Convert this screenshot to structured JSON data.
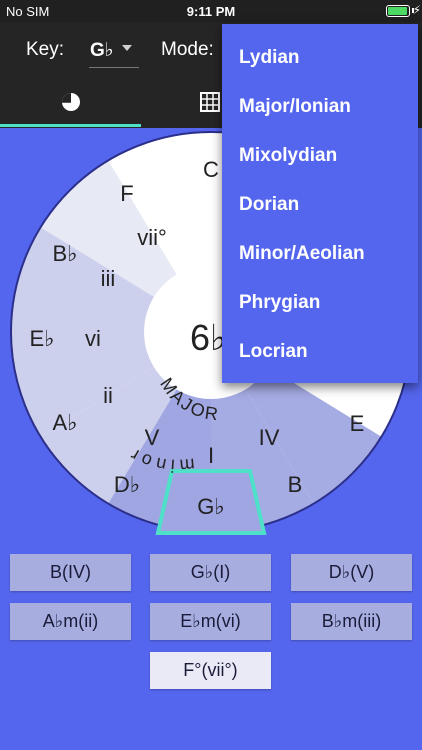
{
  "status": {
    "carrier": "No SIM",
    "time": "9:11 PM",
    "charge_icon": "⚡"
  },
  "header": {
    "key_label": "Key:",
    "key_value": "G♭",
    "mode_label": "Mode:"
  },
  "tabs": [
    {
      "name": "circle",
      "icon": "pie-chart-icon",
      "selected": true
    },
    {
      "name": "table",
      "icon": "grid-icon",
      "selected": false
    }
  ],
  "colors": {
    "accent": "#4ee0c8",
    "background": "#5566ee",
    "toolbar": "#252525",
    "selected_outline": "#4ee0c8"
  },
  "wheel": {
    "center_text": "6♭",
    "major_label": "MAJOR",
    "minor_label": "minor",
    "segments": [
      {
        "note": "C",
        "numeral": ""
      },
      {
        "note": "E",
        "numeral": ""
      },
      {
        "note": "B",
        "numeral": "IV"
      },
      {
        "note": "G♭",
        "numeral": "I"
      },
      {
        "note": "D♭",
        "numeral": "V"
      },
      {
        "note": "A♭",
        "numeral": "ii"
      },
      {
        "note": "E♭",
        "numeral": "vi"
      },
      {
        "note": "B♭",
        "numeral": "iii"
      },
      {
        "note": "F",
        "numeral": "vii°"
      }
    ]
  },
  "chord_buttons": [
    {
      "label": "B(IV)"
    },
    {
      "label": "G♭(I)"
    },
    {
      "label": "D♭(V)"
    },
    {
      "label": "A♭m(ii)"
    },
    {
      "label": "E♭m(vi)"
    },
    {
      "label": "B♭m(iii)"
    },
    {
      "label": "F°(vii°)"
    }
  ],
  "mode_menu": {
    "options": [
      "Lydian",
      "Major/Ionian",
      "Mixolydian",
      "Dorian",
      "Minor/Aeolian",
      "Phrygian",
      "Locrian"
    ]
  }
}
